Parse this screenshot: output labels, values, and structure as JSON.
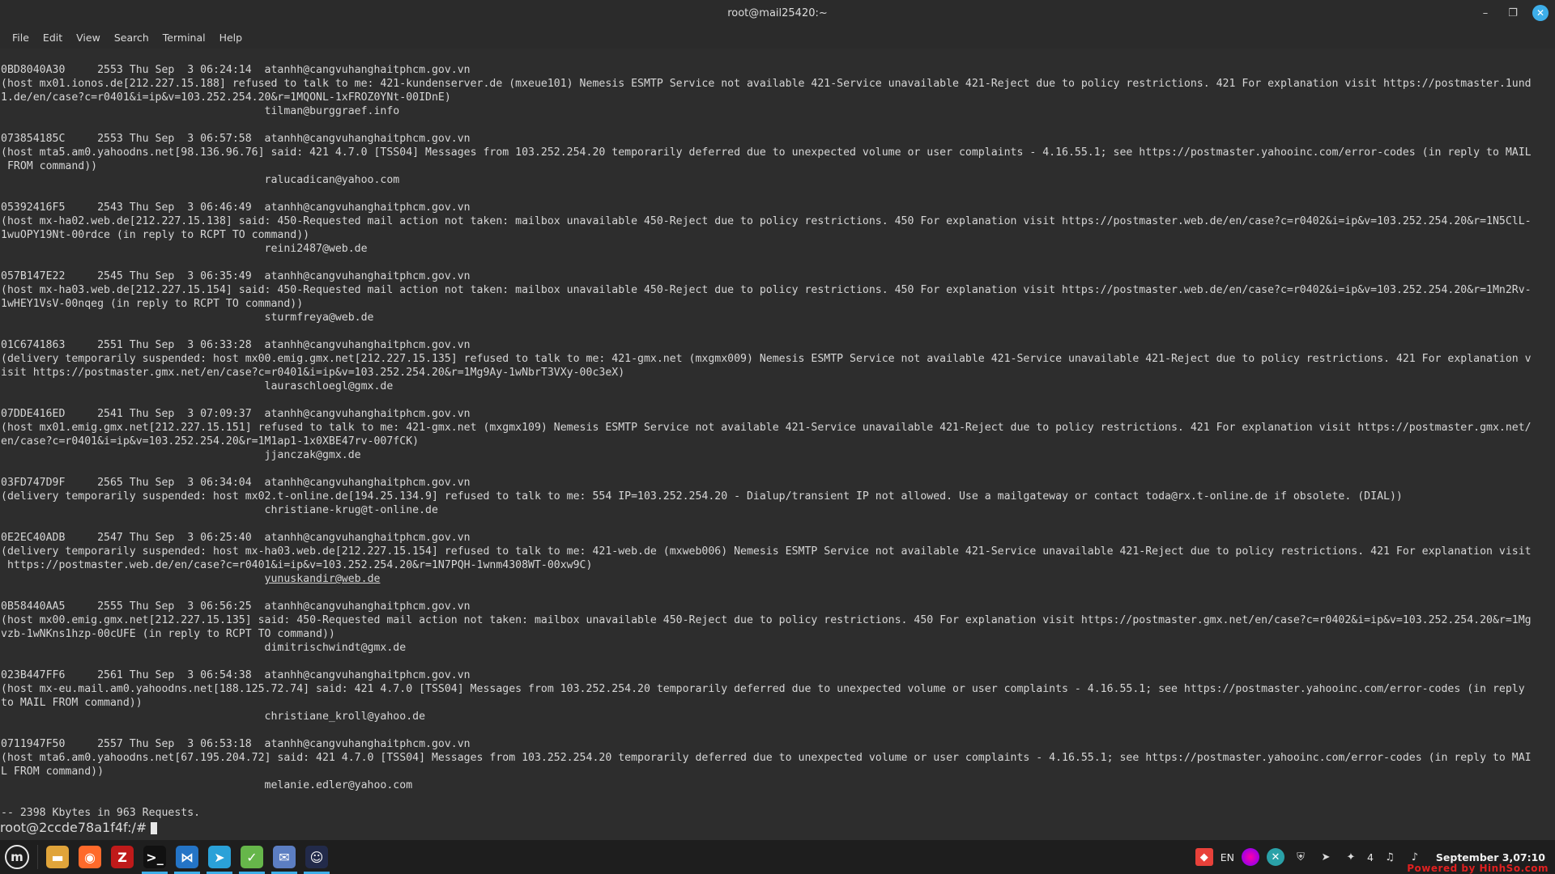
{
  "window": {
    "title": "root@mail25420:~",
    "minimize": "–",
    "maximize": "❐",
    "close": "✕"
  },
  "menu": [
    "File",
    "Edit",
    "View",
    "Search",
    "Terminal",
    "Help"
  ],
  "terminal": {
    "lines": [
      "0BD8040A30     2553 Thu Sep  3 06:24:14  atanhh@cangvuhanghaitphcm.gov.vn",
      "(host mx01.ionos.de[212.227.15.188] refused to talk to me: 421-kundenserver.de (mxeue101) Nemesis ESMTP Service not available 421-Service unavailable 421-Reject due to policy restrictions. 421 For explanation visit https://postmaster.1und",
      "1.de/en/case?c=r0401&i=ip&v=103.252.254.20&r=1MQONL-1xFROZ0YNt-00IDnE)",
      "                                         tilman@burggraef.info",
      "",
      "073854185C     2553 Thu Sep  3 06:57:58  atanhh@cangvuhanghaitphcm.gov.vn",
      "(host mta5.am0.yahoodns.net[98.136.96.76] said: 421 4.7.0 [TSS04] Messages from 103.252.254.20 temporarily deferred due to unexpected volume or user complaints - 4.16.55.1; see https://postmaster.yahooinc.com/error-codes (in reply to MAIL",
      " FROM command))",
      "                                         ralucadican@yahoo.com",
      "",
      "05392416F5     2543 Thu Sep  3 06:46:49  atanhh@cangvuhanghaitphcm.gov.vn",
      "(host mx-ha02.web.de[212.227.15.138] said: 450-Requested mail action not taken: mailbox unavailable 450-Reject due to policy restrictions. 450 For explanation visit https://postmaster.web.de/en/case?c=r0402&i=ip&v=103.252.254.20&r=1N5ClL-",
      "1wuOPY19Nt-00rdce (in reply to RCPT TO command))",
      "                                         reini2487@web.de",
      "",
      "057B147E22     2545 Thu Sep  3 06:35:49  atanhh@cangvuhanghaitphcm.gov.vn",
      "(host mx-ha03.web.de[212.227.15.154] said: 450-Requested mail action not taken: mailbox unavailable 450-Reject due to policy restrictions. 450 For explanation visit https://postmaster.web.de/en/case?c=r0402&i=ip&v=103.252.254.20&r=1Mn2Rv-",
      "1wHEY1VsV-00nqeg (in reply to RCPT TO command))",
      "                                         sturmfreya@web.de",
      "",
      "01C6741863     2551 Thu Sep  3 06:33:28  atanhh@cangvuhanghaitphcm.gov.vn",
      "(delivery temporarily suspended: host mx00.emig.gmx.net[212.227.15.135] refused to talk to me: 421-gmx.net (mxgmx009) Nemesis ESMTP Service not available 421-Service unavailable 421-Reject due to policy restrictions. 421 For explanation v",
      "isit https://postmaster.gmx.net/en/case?c=r0401&i=ip&v=103.252.254.20&r=1Mg9Ay-1wNbrT3VXy-00c3eX)",
      "                                         lauraschloegl@gmx.de",
      "",
      "07DDE416ED     2541 Thu Sep  3 07:09:37  atanhh@cangvuhanghaitphcm.gov.vn",
      "(host mx01.emig.gmx.net[212.227.15.151] refused to talk to me: 421-gmx.net (mxgmx109) Nemesis ESMTP Service not available 421-Service unavailable 421-Reject due to policy restrictions. 421 For explanation visit https://postmaster.gmx.net/",
      "en/case?c=r0401&i=ip&v=103.252.254.20&r=1M1ap1-1x0XBE47rv-007fCK)",
      "                                         jjanczak@gmx.de",
      "",
      "03FD747D9F     2565 Thu Sep  3 06:34:04  atanhh@cangvuhanghaitphcm.gov.vn",
      "(delivery temporarily suspended: host mx02.t-online.de[194.25.134.9] refused to talk to me: 554 IP=103.252.254.20 - Dialup/transient IP not allowed. Use a mailgateway or contact toda@rx.t-online.de if obsolete. (DIAL))",
      "                                         christiane-krug@t-online.de",
      "",
      "0E2EC40ADB     2547 Thu Sep  3 06:25:40  atanhh@cangvuhanghaitphcm.gov.vn",
      "(delivery temporarily suspended: host mx-ha03.web.de[212.227.15.154] refused to talk to me: 421-web.de (mxweb006) Nemesis ESMTP Service not available 421-Service unavailable 421-Reject due to policy restrictions. 421 For explanation visit",
      " https://postmaster.web.de/en/case?c=r0401&i=ip&v=103.252.254.20&r=1N7PQH-1wnm4308WT-00xw9C)",
      "                                         yunuskandir@web.de",
      "",
      "0B58440AA5     2555 Thu Sep  3 06:56:25  atanhh@cangvuhanghaitphcm.gov.vn",
      "(host mx00.emig.gmx.net[212.227.15.135] said: 450-Requested mail action not taken: mailbox unavailable 450-Reject due to policy restrictions. 450 For explanation visit https://postmaster.gmx.net/en/case?c=r0402&i=ip&v=103.252.254.20&r=1Mg",
      "vzb-1wNKns1hzp-00cUFE (in reply to RCPT TO command))",
      "                                         dimitrischwindt@gmx.de",
      "",
      "023B447FF6     2561 Thu Sep  3 06:54:38  atanhh@cangvuhanghaitphcm.gov.vn",
      "(host mx-eu.mail.am0.yahoodns.net[188.125.72.74] said: 421 4.7.0 [TSS04] Messages from 103.252.254.20 temporarily deferred due to unexpected volume or user complaints - 4.16.55.1; see https://postmaster.yahooinc.com/error-codes (in reply",
      "to MAIL FROM command))",
      "                                         christiane_kroll@yahoo.de",
      "",
      "0711947F50     2557 Thu Sep  3 06:53:18  atanhh@cangvuhanghaitphcm.gov.vn",
      "(host mta6.am0.yahoodns.net[67.195.204.72] said: 421 4.7.0 [TSS04] Messages from 103.252.254.20 temporarily deferred due to unexpected volume or user complaints - 4.16.55.1; see https://postmaster.yahooinc.com/error-codes (in reply to MAI",
      "L FROM command))",
      "                                         melanie.edler@yahoo.com",
      "",
      "-- 2398 Kbytes in 963 Requests."
    ],
    "link_line_index": 37,
    "prompt": "root@2ccde78a1f4f:/# "
  },
  "taskbar": {
    "start_label": "m",
    "apps": [
      {
        "name": "files-app-icon",
        "glyph": "▬",
        "color": "#e0a43a",
        "active": false
      },
      {
        "name": "firefox-app-icon",
        "glyph": "◉",
        "color": "#ff6a2b",
        "active": false
      },
      {
        "name": "filezilla-app-icon",
        "glyph": "Z",
        "color": "#bf1a1a",
        "active": false
      },
      {
        "name": "terminal-app-icon",
        "glyph": ">_",
        "color": "#111111",
        "active": true
      },
      {
        "name": "vscode-app-icon",
        "glyph": "⋈",
        "color": "#2474c6",
        "active": true
      },
      {
        "name": "telegram-app-icon",
        "glyph": "➤",
        "color": "#2aa1d8",
        "active": true
      },
      {
        "name": "update-app-icon",
        "glyph": "✓",
        "color": "#66b64a",
        "active": true
      },
      {
        "name": "mail-app-icon",
        "glyph": "✉",
        "color": "#5c7ec2",
        "active": true
      },
      {
        "name": "chat-app-icon",
        "glyph": "☺",
        "color": "#222a4a",
        "active": true
      }
    ],
    "tray": {
      "lang": "EN",
      "notification_count": "4",
      "clock": "September  3,07:10"
    },
    "watermark": "Powered by HinhSo.com"
  }
}
